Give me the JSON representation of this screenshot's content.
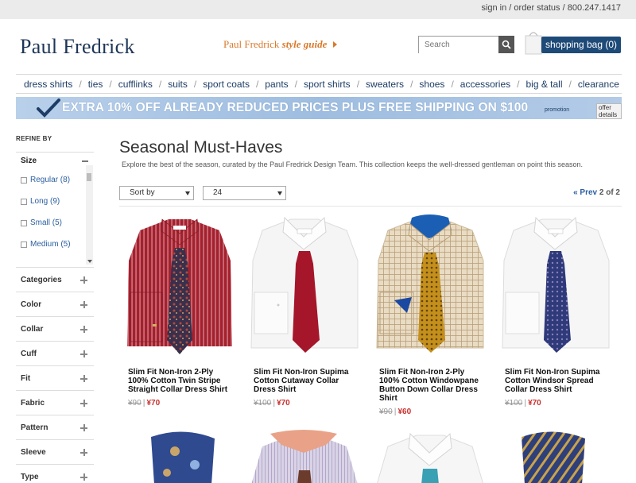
{
  "topbar": {
    "sign_in": "sign in",
    "order_status": "order status",
    "phone": "800.247.1417"
  },
  "header": {
    "logo": "Paul Fredrick",
    "style_guide_brand": "Paul Fredrick",
    "style_guide_label": "style guide",
    "search_placeholder": "Search",
    "bag_label": "shopping bag (0)"
  },
  "nav": {
    "items": [
      "dress shirts",
      "ties",
      "cufflinks",
      "suits",
      "sport coats",
      "pants",
      "sport shirts",
      "sweaters",
      "shoes",
      "accessories",
      "big & tall",
      "clearance"
    ]
  },
  "promo": {
    "text": "EXTRA 10% OFF ALREADY REDUCED PRICES PLUS FREE SHIPPING ON $100",
    "small": "promotion",
    "details": "offer details",
    "color": "#a9c4e3"
  },
  "sidebar": {
    "refine": "REFINE BY",
    "size_label": "Size",
    "sizes": [
      {
        "label": "Regular (8)"
      },
      {
        "label": "Long (9)"
      },
      {
        "label": "Small (5)"
      },
      {
        "label": "Medium (5)"
      }
    ],
    "facets": [
      "Categories",
      "Color",
      "Collar",
      "Cuff",
      "Fit",
      "Fabric",
      "Pattern",
      "Sleeve",
      "Type"
    ]
  },
  "main": {
    "title": "Seasonal Must-Haves",
    "description": "Explore the best of the season, curated by the Paul Fredrick Design Team. This collection keeps the well-dressed gentleman on point this season.",
    "sort_label": "Sort by",
    "per_page": "24",
    "pager_prev": "« Prev",
    "pager_page": "2",
    "pager_of": "of 2"
  },
  "products": [
    {
      "name": "Slim Fit Non-Iron 2-Ply 100% Cotton Twin Stripe Straight Collar Dress Shirt",
      "old": "¥90",
      "new": "¥70"
    },
    {
      "name": "Slim Fit Non-Iron Supima Cotton Cutaway Collar Dress Shirt",
      "old": "¥100",
      "new": "¥70"
    },
    {
      "name": "Slim Fit Non-Iron 2-Ply 100% Cotton Windowpane Button Down Collar Dress Shirt",
      "old": "¥90",
      "new": "¥60"
    },
    {
      "name": "Slim Fit Non-Iron Supima Cotton Windsor Spread Collar Dress Shirt",
      "old": "¥100",
      "new": "¥70"
    }
  ],
  "colors": {
    "brand_navy": "#1d3557",
    "accent_orange": "#d9792b",
    "sale_red": "#c9302c",
    "bag_blue": "#1e4a78"
  }
}
